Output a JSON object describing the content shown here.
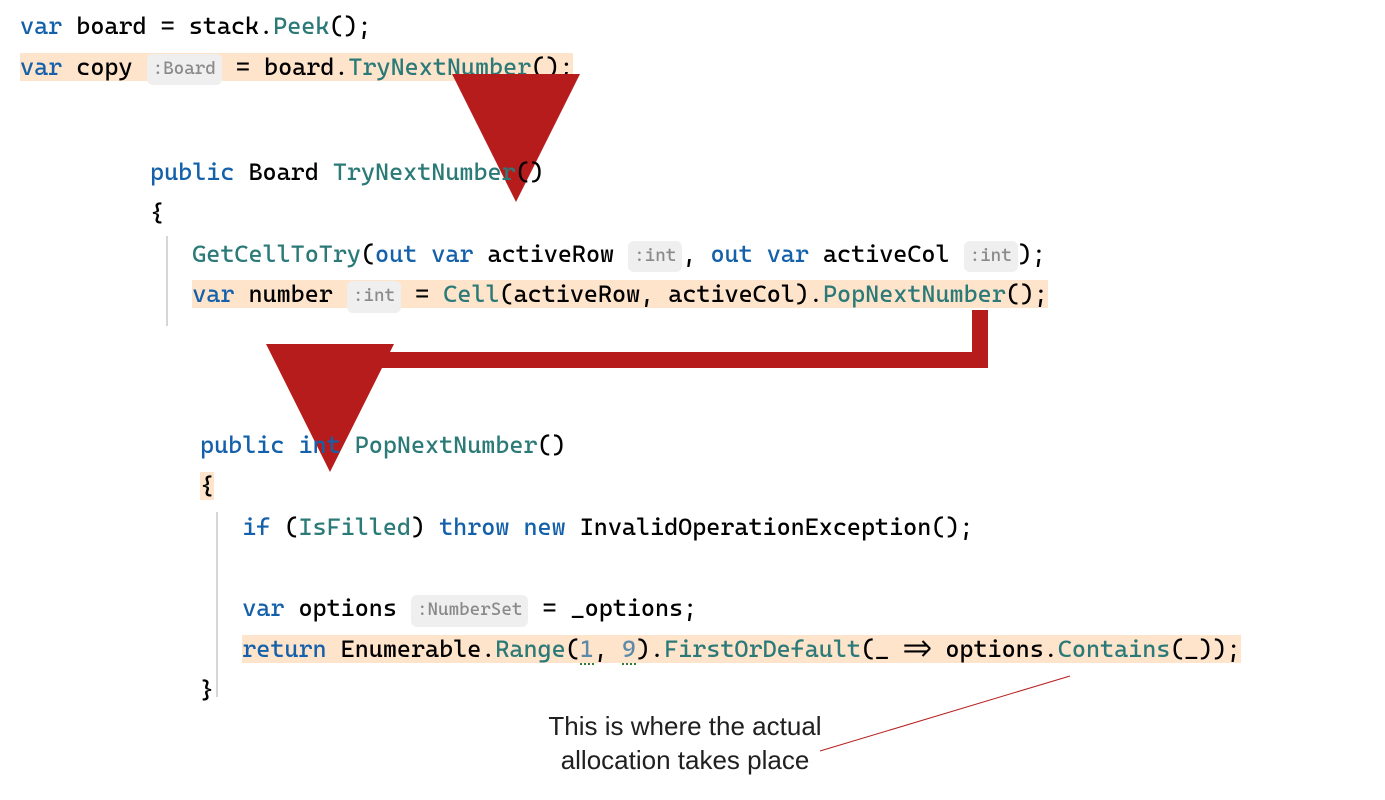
{
  "theme": {
    "highlight": "#ffe4cc",
    "arrow": "#b71c1c",
    "hint_bg": "#efefef",
    "gutter": "#d6d6d6"
  },
  "annotation": {
    "text": "This is where the actual\nallocation takes place"
  },
  "snippet1": {
    "line1": {
      "var": "var",
      "name": "board",
      "eq": "=",
      "obj": "stack",
      "dot": ".",
      "method": "Peek",
      "parens": "();"
    },
    "line2": {
      "var": "var",
      "name": "copy",
      "hint": ":Board",
      "eq": "=",
      "obj": "board",
      "dot": ".",
      "method": "TryNextNumber",
      "parens": "();"
    }
  },
  "snippet2": {
    "sig": {
      "kw_public": "public",
      "type": "Board",
      "name": "TryNextNumber",
      "parens": "()"
    },
    "brace_open": "{",
    "brace_close": "}",
    "body1": {
      "fn": "GetCellToTry",
      "open": "(",
      "out1": "out",
      "var1": "var",
      "p1": "activeRow",
      "hint1": ":int",
      "comma": ",",
      "out2": "out",
      "var2": "var",
      "p2": "activeCol",
      "hint2": ":int",
      "close": ");"
    },
    "body2": {
      "var": "var",
      "name": "number",
      "hint": ":int",
      "eq": "=",
      "fn": "Cell",
      "open": "(",
      "p1": "activeRow",
      "comma": ",",
      "p2": "activeCol",
      "close": ")",
      "dot": ".",
      "method": "PopNextNumber",
      "parens": "();"
    }
  },
  "snippet3": {
    "sig": {
      "kw_public": "public",
      "type": "int",
      "name": "PopNextNumber",
      "parens": "()"
    },
    "brace_open": "{",
    "brace_close": "}",
    "body1": {
      "if": "if",
      "open": "(",
      "prop": "IsFilled",
      "close": ")",
      "throw": "throw",
      "new": "new",
      "exc": "InvalidOperationException();"
    },
    "body2": {
      "var": "var",
      "name": "options",
      "hint": ":NumberSet",
      "eq": "=",
      "rhs": "_options;"
    },
    "body3": {
      "return": "return",
      "obj": "Enumerable",
      "dot1": ".",
      "range": "Range",
      "open1": "(",
      "n1": "1",
      "comma1": ",",
      "n9": "9",
      "close1": ")",
      "dot2": ".",
      "fod": "FirstOrDefault",
      "open2": "(",
      "lam1": "_",
      "arrow": "=>",
      "lam2": "options",
      "dot3": ".",
      "contains": "Contains",
      "open3": "(",
      "lam3": "_",
      "close3": "));"
    }
  }
}
